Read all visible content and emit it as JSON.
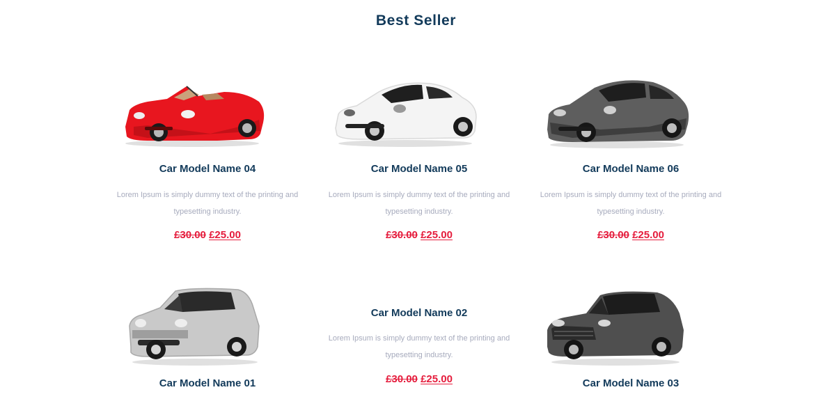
{
  "section": {
    "title": "Best Seller"
  },
  "colors": {
    "heading": "#123a5a",
    "description": "#a7abbd",
    "price": "#e51c3c"
  },
  "products": [
    {
      "name": "Car Model Name 04",
      "description": "Lorem Ipsum is simply dummy text of the printing and typesetting industry.",
      "old_price": "£30.00",
      "price": "£25.00",
      "image": "red-convertible-sports-car"
    },
    {
      "name": "Car Model Name 05",
      "description": "Lorem Ipsum is simply dummy text of the printing and typesetting industry.",
      "old_price": "£30.00",
      "price": "£25.00",
      "image": "white-sports-coupe"
    },
    {
      "name": "Car Model Name 06",
      "description": "Lorem Ipsum is simply dummy text of the printing and typesetting industry.",
      "old_price": "£30.00",
      "price": "£25.00",
      "image": "grey-four-door-sedan"
    },
    {
      "name": "Car Model Name 01",
      "image": "silver-suv"
    },
    {
      "name": "Car Model Name 02",
      "description": "Lorem Ipsum is simply dummy text of the printing and typesetting industry.",
      "old_price": "£30.00",
      "price": "£25.00"
    },
    {
      "name": "Car Model Name 03",
      "image": "dark-grey-compact-suv"
    }
  ]
}
